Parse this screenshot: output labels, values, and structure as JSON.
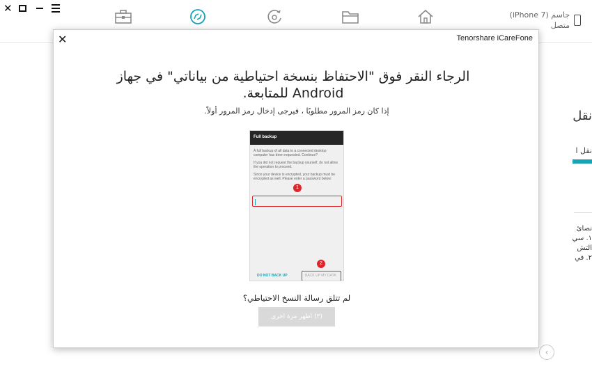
{
  "app": {
    "device_name": "جاسم (iPhone 7)",
    "device_status": "متصل",
    "nav_items": [
      {
        "icon": "toolbox-icon"
      },
      {
        "icon": "whatsapp-transfer-icon",
        "active": true
      },
      {
        "icon": "backup-restore-icon"
      },
      {
        "icon": "folder-icon"
      },
      {
        "icon": "home-icon"
      }
    ],
    "side_title": "نقل",
    "side_sub": "نقل ا",
    "side_tips": [
      "نصائ",
      "١. سي",
      "التش",
      "٢. في"
    ],
    "accent_color": "#16a3b6"
  },
  "modal": {
    "title": "Tenorshare iCareFone",
    "heading": "الرجاء النقر فوق \"الاحتفاظ بنسخة احتياطية من بياناتي\" في جهاز Android للمتابعة.",
    "note": "إذا كان رمز المرور مطلوبًا ، فيرجى إدخال رمز المرور أولاً.",
    "question": "لم تتلق رسالة النسخ الاحتياطي؟",
    "button_label": "(٣) اظهر مرة اخرى"
  },
  "phone_screenshot": {
    "header": "Full backup",
    "paragraphs": [
      "A full backup of all data to a connected desktop computer has been requested. Continue?",
      "If you did not request the backup yourself, do not allow the operation to proceed.",
      "Since your device is encrypted, your backup must be encrypted as well. Please enter a password below:"
    ],
    "btn_decline": "DO NOT BACK UP",
    "btn_accept": "BACK UP MY DATA",
    "step_1": "1",
    "step_2": "2",
    "highlight_color": "#e0262a"
  }
}
